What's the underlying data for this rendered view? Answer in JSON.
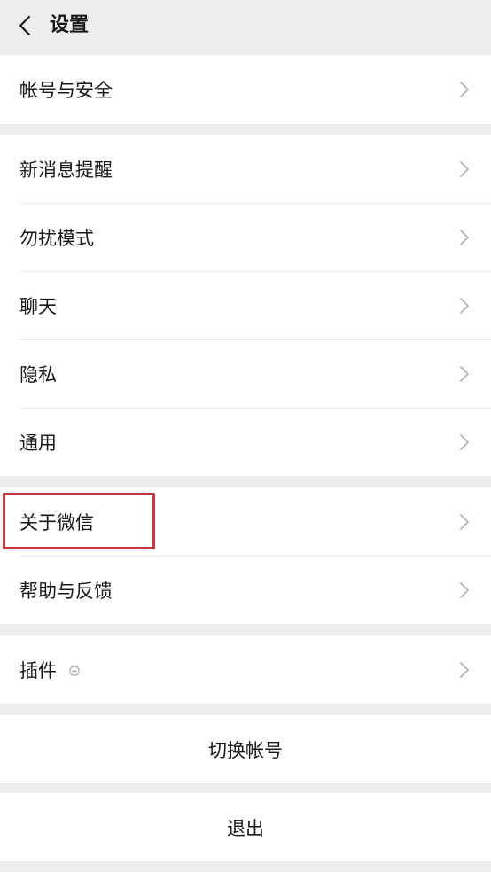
{
  "nav": {
    "title": "设置"
  },
  "group1": [
    {
      "label": "帐号与安全"
    }
  ],
  "group2": [
    {
      "label": "新消息提醒"
    },
    {
      "label": "勿扰模式"
    },
    {
      "label": "聊天"
    },
    {
      "label": "隐私"
    },
    {
      "label": "通用"
    }
  ],
  "group3": [
    {
      "label": "关于微信"
    },
    {
      "label": "帮助与反馈"
    }
  ],
  "group4": [
    {
      "label": "插件",
      "icon": "plugin-icon"
    }
  ],
  "actions": {
    "switch_account": "切换帐号",
    "logout": "退出"
  },
  "colors": {
    "background": "#ededed",
    "cell": "#ffffff",
    "highlight_border": "#c63a3f"
  }
}
